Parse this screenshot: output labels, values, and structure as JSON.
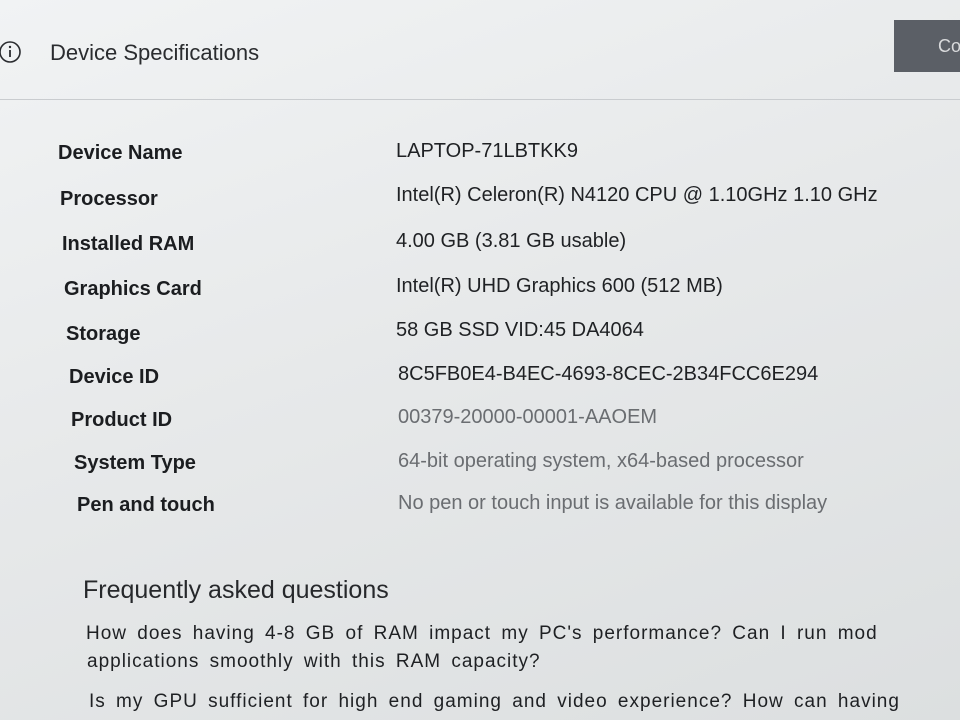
{
  "header": {
    "title": "Device Specifications",
    "copy_label": "Copy"
  },
  "specs": [
    {
      "label": "Device Name",
      "value": "LAPTOP-71LBTKK9"
    },
    {
      "label": "Processor",
      "value": "Intel(R) Celeron(R) N4120 CPU @ 1.10GHz   1.10 GHz"
    },
    {
      "label": "Installed RAM",
      "value": "4.00 GB (3.81 GB usable)"
    },
    {
      "label": "Graphics Card",
      "value": "Intel(R) UHD Graphics 600 (512 MB)"
    },
    {
      "label": "Storage",
      "value": "58 GB SSD VID:45 DA4064"
    },
    {
      "label": "Device ID",
      "value": "8C5FB0E4-B4EC-4693-8CEC-2B34FCC6E294"
    },
    {
      "label": "Product ID",
      "value": "00379-20000-00001-AAOEM"
    },
    {
      "label": "System Type",
      "value": "64-bit operating system, x64-based processor"
    },
    {
      "label": "Pen and touch",
      "value": "No pen or touch input is available for this display"
    }
  ],
  "faq": {
    "title": "Frequently asked questions",
    "q1_line1": "How does having 4-8 GB of RAM impact my PC's performance? Can I run mod",
    "q1_line2": "applications smoothly with this RAM capacity?",
    "q2_line1": "Is my GPU sufficient for high end gaming and video experience? How can having"
  }
}
